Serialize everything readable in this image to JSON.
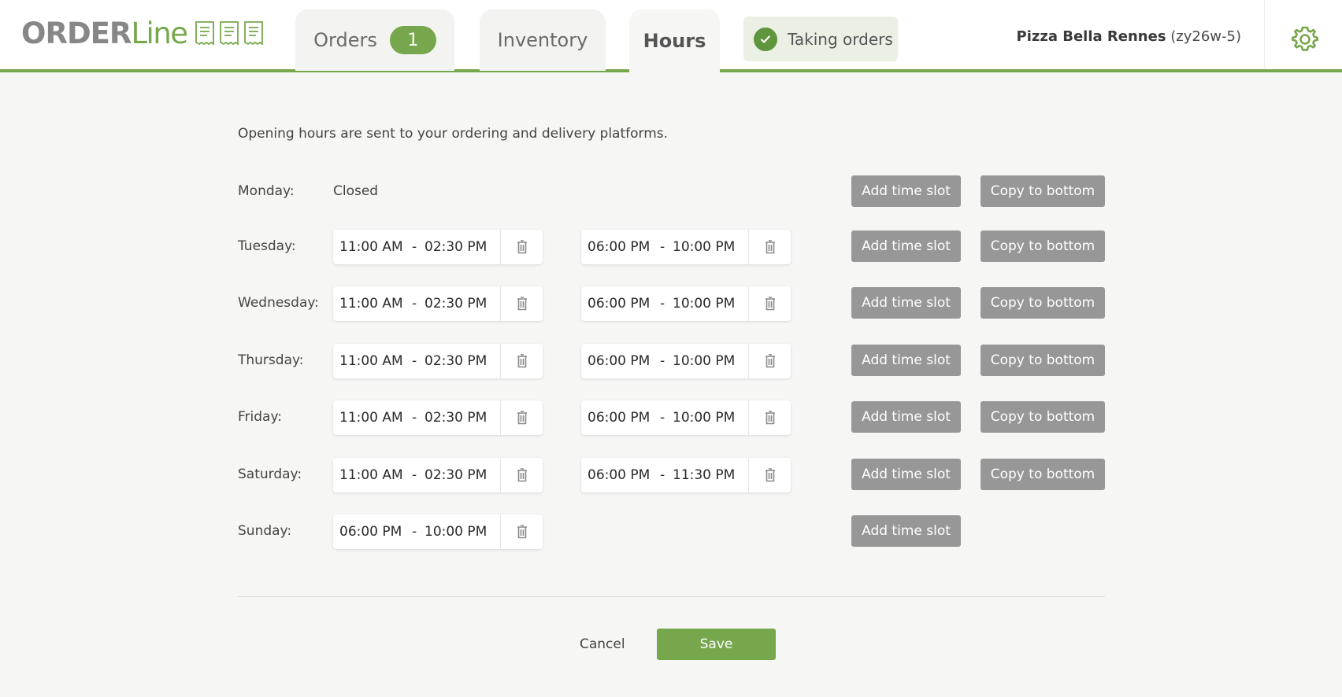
{
  "app": {
    "logo_bold": "ORDER",
    "logo_light": "Line"
  },
  "tabs": {
    "orders": {
      "label": "Orders",
      "badge": "1"
    },
    "inventory": {
      "label": "Inventory"
    },
    "hours": {
      "label": "Hours"
    }
  },
  "status": {
    "label": "Taking orders",
    "color": "#5f953d"
  },
  "restaurant": {
    "name": "Pizza Bella Rennes",
    "code": "(zy26w-5)"
  },
  "colors": {
    "accent": "#77a74d",
    "button_gray": "#979797"
  },
  "hours": {
    "intro": "Opening hours are sent to your ordering and delivery platforms.",
    "add_label": "Add time slot",
    "copy_label": "Copy to bottom",
    "closed_label": "Closed",
    "days": [
      {
        "label": "Monday:",
        "closed": true,
        "slots": []
      },
      {
        "label": "Tuesday:",
        "slots": [
          {
            "from": "11:00 AM",
            "to": "02:30 PM"
          },
          {
            "from": "06:00 PM",
            "to": "10:00 PM"
          }
        ]
      },
      {
        "label": "Wednesday:",
        "slots": [
          {
            "from": "11:00 AM",
            "to": "02:30 PM"
          },
          {
            "from": "06:00 PM",
            "to": "10:00 PM"
          }
        ]
      },
      {
        "label": "Thursday:",
        "slots": [
          {
            "from": "11:00 AM",
            "to": "02:30 PM"
          },
          {
            "from": "06:00 PM",
            "to": "10:00 PM"
          }
        ]
      },
      {
        "label": "Friday:",
        "slots": [
          {
            "from": "11:00 AM",
            "to": "02:30 PM"
          },
          {
            "from": "06:00 PM",
            "to": "10:00 PM"
          }
        ]
      },
      {
        "label": "Saturday:",
        "slots": [
          {
            "from": "11:00 AM",
            "to": "02:30 PM"
          },
          {
            "from": "06:00 PM",
            "to": "11:30 PM"
          }
        ]
      },
      {
        "label": "Sunday:",
        "slots": [
          {
            "from": "06:00 PM",
            "to": "10:00 PM"
          }
        ]
      }
    ]
  },
  "footer": {
    "cancel_label": "Cancel",
    "save_label": "Save"
  }
}
